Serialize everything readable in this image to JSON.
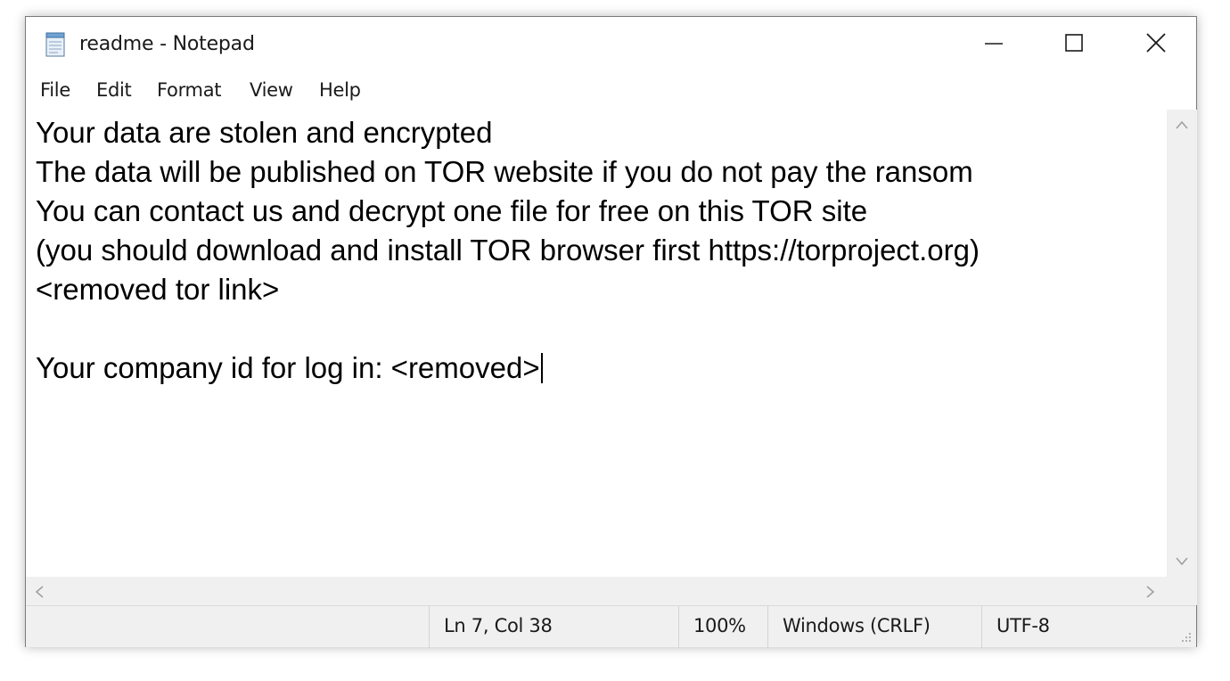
{
  "window": {
    "title": "readme - Notepad"
  },
  "menu": [
    "File",
    "Edit",
    "Format",
    "View",
    "Help"
  ],
  "editor": {
    "lines": [
      "Your data are stolen and encrypted",
      "The data will be published on TOR website if you do not pay the ransom",
      "You can contact us and decrypt one file for free on this TOR site",
      "(you should download and install TOR browser first https://torproject.org)",
      "<removed tor link>",
      "",
      "Your company id for log in: <removed>"
    ]
  },
  "status": {
    "position": "Ln 7, Col 38",
    "zoom": "100%",
    "line_ending": "Windows (CRLF)",
    "encoding": "UTF-8"
  },
  "icons": {
    "app": "notepad-icon",
    "minimize": "minimize-icon",
    "maximize": "maximize-icon",
    "close": "close-icon"
  },
  "colors": {
    "window_bg": "#ffffff",
    "chrome_bg": "#f0f0f0",
    "text": "#000000"
  }
}
